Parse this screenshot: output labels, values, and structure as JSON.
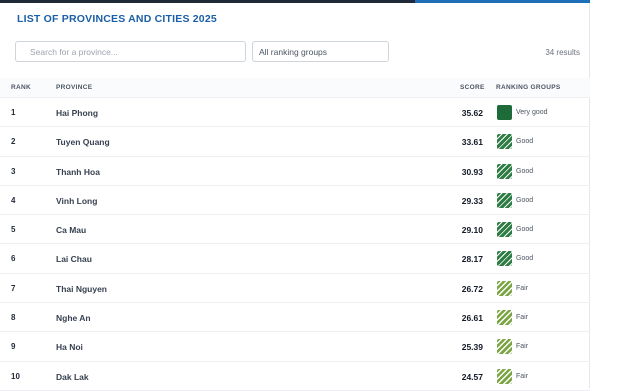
{
  "title": "LIST OF PROVINCES AND CITIES 2025",
  "search": {
    "placeholder": "Search for a province..."
  },
  "group_filter": {
    "selected": "All ranking groups"
  },
  "results_text": "34 results",
  "columns": {
    "rank": "RANK",
    "province": "PROVINCE",
    "score": "SCORE",
    "group": "RANKING GROUPS"
  },
  "colors": {
    "title": "#1b5fa6",
    "very_good": "#1e6b3a",
    "good": "#2e7d44",
    "fair": "#7aa542"
  },
  "rows": [
    {
      "rank": "1",
      "province": "Hai Phong",
      "score": "35.62",
      "group": "Very good",
      "badge": "vg"
    },
    {
      "rank": "2",
      "province": "Tuyen Quang",
      "score": "33.61",
      "group": "Good",
      "badge": "good"
    },
    {
      "rank": "3",
      "province": "Thanh Hoa",
      "score": "30.93",
      "group": "Good",
      "badge": "good"
    },
    {
      "rank": "4",
      "province": "Vinh Long",
      "score": "29.33",
      "group": "Good",
      "badge": "good"
    },
    {
      "rank": "5",
      "province": "Ca Mau",
      "score": "29.10",
      "group": "Good",
      "badge": "good"
    },
    {
      "rank": "6",
      "province": "Lai Chau",
      "score": "28.17",
      "group": "Good",
      "badge": "good"
    },
    {
      "rank": "7",
      "province": "Thai Nguyen",
      "score": "26.72",
      "group": "Fair",
      "badge": "fair"
    },
    {
      "rank": "8",
      "province": "Nghe An",
      "score": "26.61",
      "group": "Fair",
      "badge": "fair"
    },
    {
      "rank": "9",
      "province": "Ha Noi",
      "score": "25.39",
      "group": "Fair",
      "badge": "fair"
    },
    {
      "rank": "10",
      "province": "Dak Lak",
      "score": "24.57",
      "group": "Fair",
      "badge": "fair"
    }
  ]
}
